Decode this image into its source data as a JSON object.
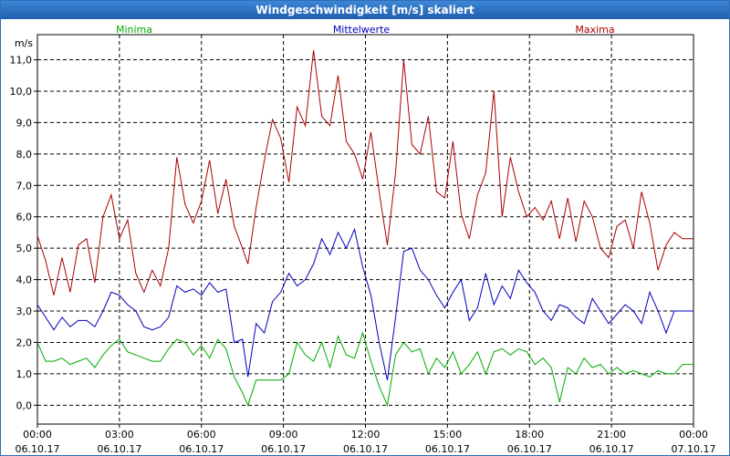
{
  "window": {
    "title": "Windgeschwindigkeit [m/s] skaliert"
  },
  "chart_data": {
    "type": "line",
    "title": "Windgeschwindigkeit [m/s] skaliert",
    "ylabel": "m/s",
    "ylim": [
      -0.6,
      11.8
    ],
    "ytick_values": [
      0,
      1,
      2,
      3,
      4,
      5,
      6,
      7,
      8,
      9,
      10,
      11
    ],
    "ytick_labels": [
      "0,0",
      "1,0",
      "2,0",
      "3,0",
      "4,0",
      "5,0",
      "6,0",
      "7,0",
      "8,0",
      "9,0",
      "10,0",
      "11,0"
    ],
    "x_ticks": [
      {
        "time": "00:00",
        "date": "06.10.17"
      },
      {
        "time": "03:00",
        "date": "06.10.17"
      },
      {
        "time": "06:00",
        "date": "06.10.17"
      },
      {
        "time": "09:00",
        "date": "06.10.17"
      },
      {
        "time": "12:00",
        "date": "06.10.17"
      },
      {
        "time": "15:00",
        "date": "06.10.17"
      },
      {
        "time": "18:00",
        "date": "06.10.17"
      },
      {
        "time": "21:00",
        "date": "06.10.17"
      },
      {
        "time": "00:00",
        "date": "07.10.17"
      }
    ],
    "grid": true,
    "series": [
      {
        "name": "Minima",
        "color": "#00aa00",
        "x_hours": [
          0,
          0.3,
          0.6,
          0.9,
          1.2,
          1.5,
          1.8,
          2.1,
          2.4,
          2.7,
          3.0,
          3.3,
          3.6,
          3.9,
          4.2,
          4.5,
          4.8,
          5.1,
          5.4,
          5.7,
          6.0,
          6.3,
          6.6,
          6.9,
          7.2,
          7.5,
          7.7,
          8.0,
          8.3,
          8.6,
          8.9,
          9.2,
          9.5,
          9.8,
          10.1,
          10.4,
          10.7,
          11.0,
          11.3,
          11.6,
          11.9,
          12.2,
          12.5,
          12.8,
          13.1,
          13.4,
          13.7,
          14.0,
          14.3,
          14.6,
          14.9,
          15.2,
          15.5,
          15.8,
          16.1,
          16.4,
          16.7,
          17.0,
          17.3,
          17.6,
          17.9,
          18.2,
          18.5,
          18.8,
          19.1,
          19.4,
          19.7,
          20.0,
          20.3,
          20.6,
          20.9,
          21.2,
          21.5,
          21.8,
          22.1,
          22.4,
          22.7,
          23.0,
          23.3,
          23.6,
          24.0
        ],
        "values": [
          2.0,
          1.4,
          1.4,
          1.5,
          1.3,
          1.4,
          1.5,
          1.2,
          1.6,
          1.9,
          2.1,
          1.7,
          1.6,
          1.5,
          1.4,
          1.4,
          1.8,
          2.1,
          2.0,
          1.6,
          1.9,
          1.5,
          2.1,
          1.8,
          0.9,
          0.4,
          0.0,
          0.8,
          0.8,
          0.8,
          0.8,
          1.0,
          2.0,
          1.6,
          1.4,
          2.0,
          1.2,
          2.2,
          1.6,
          1.5,
          2.3,
          1.4,
          0.6,
          0.0,
          1.6,
          2.0,
          1.7,
          1.8,
          1.0,
          1.5,
          1.2,
          1.7,
          1.0,
          1.3,
          1.7,
          1.0,
          1.7,
          1.8,
          1.6,
          1.8,
          1.7,
          1.3,
          1.5,
          1.2,
          0.1,
          1.2,
          1.0,
          1.5,
          1.2,
          1.3,
          1.0,
          1.2,
          1.0,
          1.1,
          1.0,
          0.9,
          1.1,
          1.0,
          1.0,
          1.3,
          1.3
        ]
      },
      {
        "name": "Mittelwerte",
        "color": "#0000bb",
        "x_hours": [
          0,
          0.3,
          0.6,
          0.9,
          1.2,
          1.5,
          1.8,
          2.1,
          2.4,
          2.7,
          3.0,
          3.3,
          3.6,
          3.9,
          4.2,
          4.5,
          4.8,
          5.1,
          5.4,
          5.7,
          6.0,
          6.3,
          6.6,
          6.9,
          7.2,
          7.5,
          7.7,
          8.0,
          8.3,
          8.6,
          8.9,
          9.2,
          9.5,
          9.8,
          10.1,
          10.4,
          10.7,
          11.0,
          11.3,
          11.6,
          11.9,
          12.2,
          12.5,
          12.8,
          13.1,
          13.4,
          13.7,
          14.0,
          14.3,
          14.6,
          14.9,
          15.2,
          15.5,
          15.8,
          16.1,
          16.4,
          16.7,
          17.0,
          17.3,
          17.6,
          17.9,
          18.2,
          18.5,
          18.8,
          19.1,
          19.4,
          19.7,
          20.0,
          20.3,
          20.6,
          20.9,
          21.2,
          21.5,
          21.8,
          22.1,
          22.4,
          22.7,
          23.0,
          23.3,
          23.6,
          24.0
        ],
        "values": [
          3.2,
          2.8,
          2.4,
          2.8,
          2.5,
          2.7,
          2.7,
          2.5,
          3.0,
          3.6,
          3.5,
          3.2,
          3.0,
          2.5,
          2.4,
          2.5,
          2.8,
          3.8,
          3.6,
          3.7,
          3.5,
          3.9,
          3.6,
          3.7,
          2.0,
          2.1,
          0.9,
          2.6,
          2.3,
          3.3,
          3.6,
          4.2,
          3.8,
          4.0,
          4.5,
          5.3,
          4.8,
          5.5,
          5.0,
          5.6,
          4.4,
          3.5,
          2.0,
          0.8,
          2.8,
          4.9,
          5.0,
          4.3,
          4.0,
          3.5,
          3.1,
          3.6,
          4.0,
          2.7,
          3.1,
          4.2,
          3.2,
          3.8,
          3.4,
          4.3,
          3.9,
          3.6,
          3.0,
          2.7,
          3.2,
          3.1,
          2.8,
          2.6,
          3.4,
          3.0,
          2.6,
          2.9,
          3.2,
          3.0,
          2.6,
          3.6,
          3.0,
          2.3,
          3.0,
          3.0,
          3.0
        ]
      },
      {
        "name": "Maxima",
        "color": "#aa0000",
        "x_hours": [
          0,
          0.3,
          0.6,
          0.9,
          1.2,
          1.5,
          1.8,
          2.1,
          2.4,
          2.7,
          3.0,
          3.3,
          3.6,
          3.9,
          4.2,
          4.5,
          4.8,
          5.1,
          5.4,
          5.7,
          6.0,
          6.3,
          6.6,
          6.9,
          7.2,
          7.5,
          7.7,
          8.0,
          8.3,
          8.6,
          8.9,
          9.2,
          9.5,
          9.8,
          10.1,
          10.4,
          10.7,
          11.0,
          11.3,
          11.6,
          11.9,
          12.2,
          12.5,
          12.8,
          13.1,
          13.4,
          13.7,
          14.0,
          14.3,
          14.6,
          14.9,
          15.2,
          15.5,
          15.8,
          16.1,
          16.4,
          16.7,
          17.0,
          17.3,
          17.6,
          17.9,
          18.2,
          18.5,
          18.8,
          19.1,
          19.4,
          19.7,
          20.0,
          20.3,
          20.6,
          20.9,
          21.2,
          21.5,
          21.8,
          22.1,
          22.4,
          22.7,
          23.0,
          23.3,
          23.6,
          24.0
        ],
        "values": [
          5.4,
          4.6,
          3.5,
          4.7,
          3.6,
          5.1,
          5.3,
          3.9,
          6.0,
          6.7,
          5.3,
          5.9,
          4.2,
          3.6,
          4.3,
          3.8,
          5.0,
          7.9,
          6.4,
          5.8,
          6.5,
          7.8,
          6.1,
          7.2,
          5.7,
          5.0,
          4.5,
          6.3,
          7.8,
          9.1,
          8.5,
          7.1,
          9.5,
          8.9,
          11.3,
          9.2,
          8.9,
          10.5,
          8.4,
          8.0,
          7.2,
          8.7,
          6.8,
          5.1,
          7.4,
          11.0,
          8.3,
          8.0,
          9.2,
          6.8,
          6.6,
          8.4,
          6.1,
          5.3,
          6.7,
          7.4,
          10.0,
          6.0,
          7.9,
          6.8,
          6.0,
          6.3,
          5.9,
          6.5,
          5.3,
          6.6,
          5.2,
          6.5,
          6.0,
          5.0,
          4.7,
          5.7,
          5.9,
          5.0,
          6.8,
          5.8,
          4.3,
          5.1,
          5.5,
          5.3,
          5.3
        ]
      }
    ]
  }
}
